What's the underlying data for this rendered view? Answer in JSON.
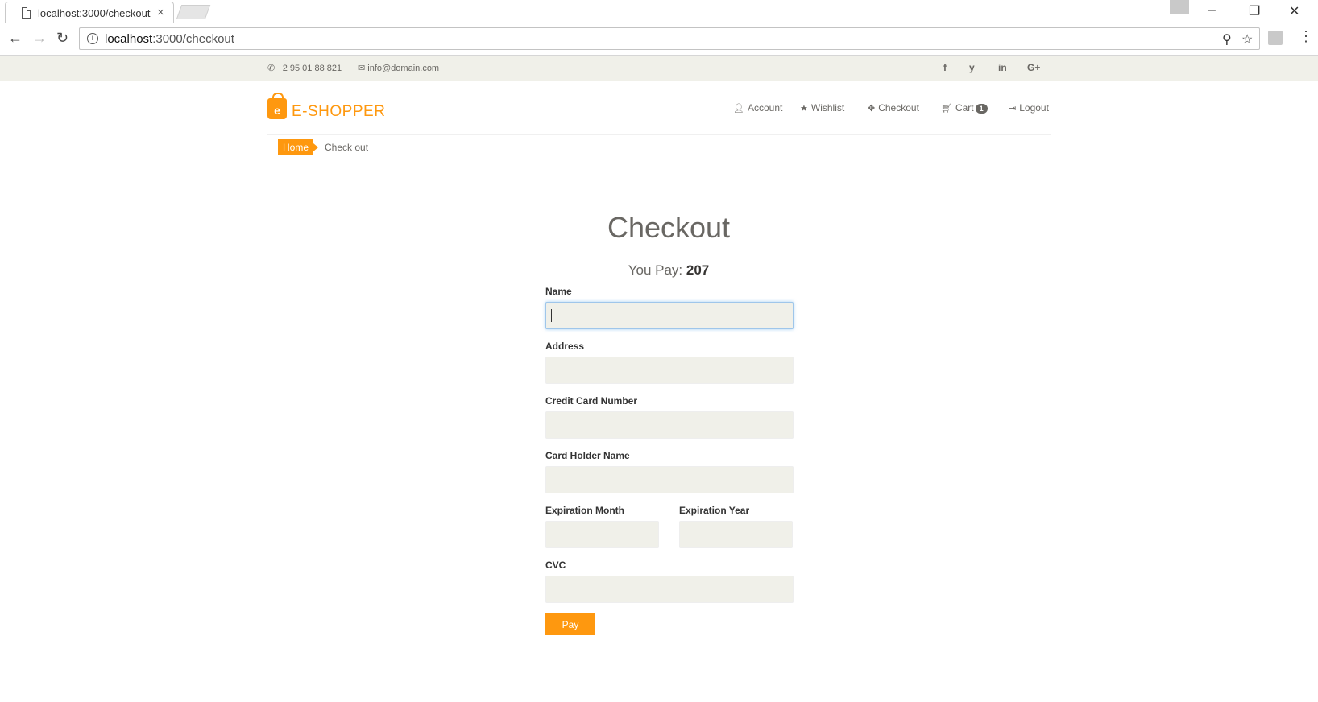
{
  "browser": {
    "tab_title": "localhost:3000/checkout",
    "url_host": "localhost",
    "url_path": ":3000/checkout"
  },
  "topbar": {
    "phone": "+2 95 01 88 821",
    "email": "info@domain.com",
    "social": [
      "f",
      "y",
      "in",
      "G+"
    ]
  },
  "logo": {
    "letter": "e",
    "text": "E-SHOPPER"
  },
  "nav": {
    "account": "Account",
    "wishlist": "Wishlist",
    "checkout": "Checkout",
    "cart": "Cart",
    "cart_count": "1",
    "logout": "Logout"
  },
  "breadcrumb": {
    "home": "Home",
    "current": "Check out"
  },
  "checkout": {
    "title": "Checkout",
    "you_pay_label": "You Pay:",
    "amount": "207",
    "fields": {
      "name": {
        "label": "Name",
        "value": ""
      },
      "address": {
        "label": "Address",
        "value": ""
      },
      "card_number": {
        "label": "Credit Card Number",
        "value": ""
      },
      "holder_name": {
        "label": "Card Holder Name",
        "value": ""
      },
      "exp_month": {
        "label": "Expiration Month",
        "value": ""
      },
      "exp_year": {
        "label": "Expiration Year",
        "value": ""
      },
      "cvc": {
        "label": "CVC",
        "value": ""
      }
    },
    "pay_button": "Pay"
  },
  "colors": {
    "accent": "#FE980F",
    "topbar_bg": "#f0f0e9",
    "text": "#696763"
  },
  "icons": [
    "page-icon",
    "close-icon",
    "back-icon",
    "forward-icon",
    "reload-icon",
    "info-icon",
    "zoom-icon",
    "star-icon",
    "phone-icon",
    "envelope-icon",
    "user-icon",
    "star-icon",
    "crosshairs-icon",
    "cart-icon",
    "logout-icon"
  ]
}
